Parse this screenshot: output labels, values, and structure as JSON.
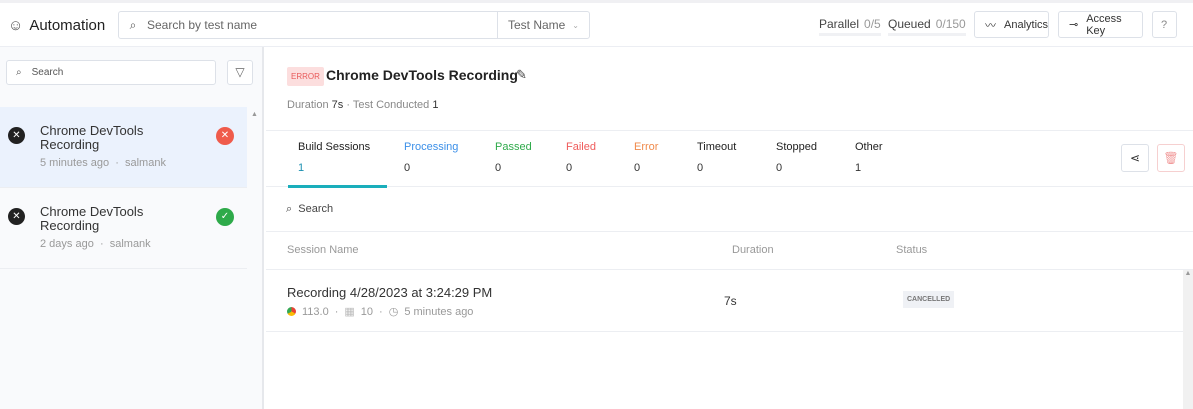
{
  "header": {
    "app_title": "Automation",
    "search_placeholder": "Search by test name",
    "search_type": "Test Name",
    "parallel_label": "Parallel",
    "parallel_value": "0/5",
    "queued_label": "Queued",
    "queued_value": "0/150",
    "analytics": "Analytics",
    "access_key": "Access Key",
    "help": "?"
  },
  "sidebar": {
    "search_placeholder": "Search",
    "items": [
      {
        "title": "Chrome DevTools Recording",
        "time": "5 minutes ago",
        "user": "salmank",
        "status": "error"
      },
      {
        "title": "Chrome DevTools Recording",
        "time": "2 days ago",
        "user": "salmank",
        "status": "passed"
      }
    ]
  },
  "detail": {
    "badge": "ERROR",
    "title": "Chrome DevTools Recording",
    "duration_label": "Duration",
    "duration": "7s",
    "conducted_label": "Test Conducted",
    "conducted": "1",
    "tabs": [
      {
        "label": "Build Sessions",
        "count": "1",
        "color": "#222222"
      },
      {
        "label": "Processing",
        "count": "0",
        "color": "#3b8fe8"
      },
      {
        "label": "Passed",
        "count": "0",
        "color": "#2eaa4a"
      },
      {
        "label": "Failed",
        "count": "0",
        "color": "#ef5b5b"
      },
      {
        "label": "Error",
        "count": "0",
        "color": "#f08a4b"
      },
      {
        "label": "Timeout",
        "count": "0",
        "color": "#222222"
      },
      {
        "label": "Stopped",
        "count": "0",
        "color": "#222222"
      },
      {
        "label": "Other",
        "count": "1",
        "color": "#222222"
      }
    ],
    "search_placeholder": "Search",
    "columns": [
      "Session Name",
      "Duration",
      "Status"
    ],
    "rows": [
      {
        "name": "Recording 4/28/2023 at 3:24:29 PM",
        "browser_version": "113.0",
        "os_version": "10",
        "time": "5 minutes ago",
        "duration": "7s",
        "status": "CANCELLED"
      }
    ]
  }
}
